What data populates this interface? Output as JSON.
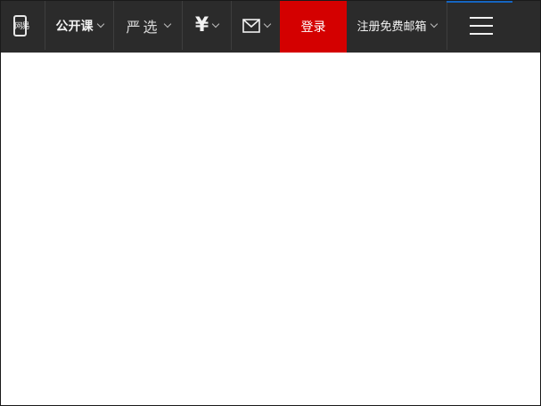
{
  "nav": {
    "app_icon_text": "网易",
    "courses_label": "公开课",
    "yanxuan_label": "严选",
    "pay_symbol": "¥",
    "login_label": "登录",
    "register_label": "注册免费邮箱"
  },
  "icons": {
    "app": "phone-icon",
    "mail": "mail-icon",
    "menu": "hamburger-menu-icon",
    "dropdown": "chevron-down-icon"
  },
  "colors": {
    "topbar": "#2b2b2b",
    "login_bg": "#d40000",
    "accent": "#1565c0"
  }
}
